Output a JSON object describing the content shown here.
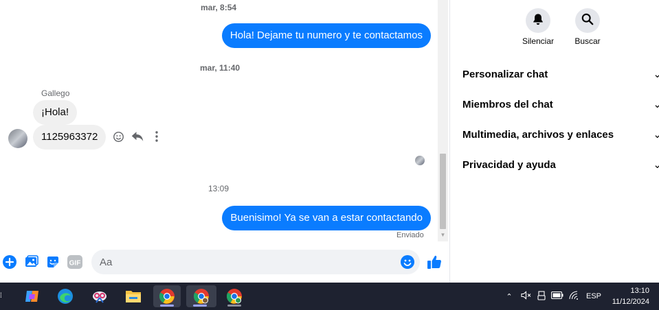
{
  "chat": {
    "timestamps": [
      "mar, 8:54",
      "mar, 11:40",
      "13:09"
    ],
    "messages": {
      "out1": "Hola! Dejame tu numero y te contactamos",
      "in1": "¡Hola!",
      "in2": "1125963372",
      "out2": "Buenisimo! Ya se van a estar contactando"
    },
    "sender_name": "Gallego",
    "delivery_status": "Enviado"
  },
  "composer": {
    "placeholder": "Aa",
    "icons": [
      "plus-icon",
      "image-icon",
      "sticker-icon",
      "gif-icon",
      "emoji-icon",
      "thumbs-up-icon"
    ],
    "gif_label": "GIF"
  },
  "panel": {
    "mute_label": "Silenciar",
    "search_label": "Buscar",
    "sections": [
      "Personalizar chat",
      "Miembros del chat",
      "Multimedia, archivos y enlaces",
      "Privacidad y ayuda"
    ]
  },
  "taskbar": {
    "apps": [
      "copilot-icon",
      "edge-icon",
      "snipping-icon",
      "file-explorer-icon",
      "chrome-icon",
      "chrome-profile-icon",
      "chrome-v-icon"
    ],
    "language": "ESP",
    "time": "13:10",
    "date": "11/12/2024"
  },
  "colors": {
    "accent": "#0a7cff",
    "taskbar": "#1e2230"
  }
}
